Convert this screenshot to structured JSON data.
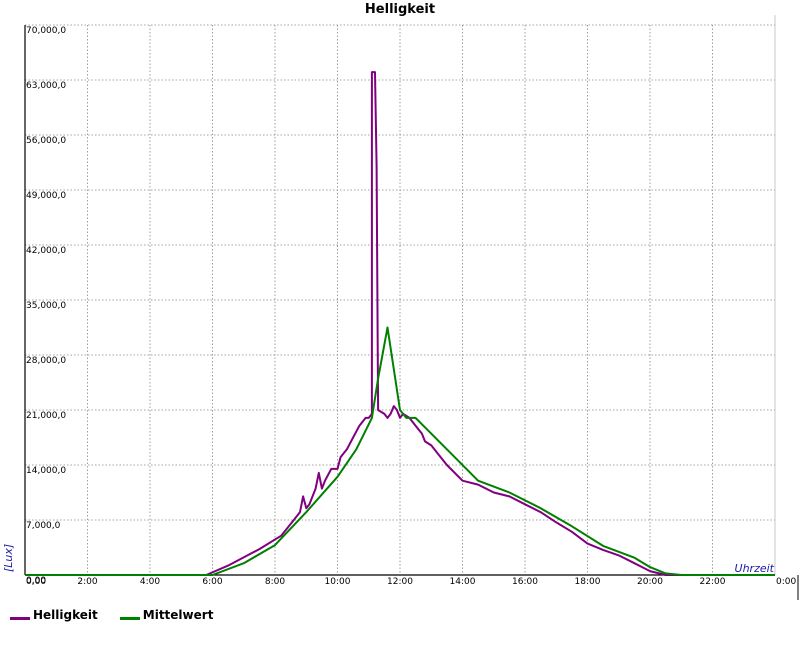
{
  "chart_data": {
    "type": "line",
    "title": "Helligkeit",
    "xlabel": "Uhrzeit",
    "ylabel": "[Lux]",
    "xlim": [
      0,
      24
    ],
    "ylim": [
      0,
      70000
    ],
    "grid": true,
    "legend_position": "bottom-left",
    "y_ticks": [
      "0,00",
      "7,000,0",
      "14,000,0",
      "21,000,0",
      "28,000,0",
      "35,000,0",
      "42,000,0",
      "49,000,0",
      "56,000,0",
      "63,000,0",
      "70,000,0"
    ],
    "x_ticks": [
      "0,00",
      "2:00",
      "4:00",
      "6:00",
      "8:00",
      "10:00",
      "12:00",
      "14:00",
      "16:00",
      "18:00",
      "20:00",
      "22:00",
      "0:00"
    ],
    "series": [
      {
        "name": "Helligkeit",
        "color": "#800080",
        "points": [
          [
            0,
            0
          ],
          [
            5.8,
            0
          ],
          [
            6.5,
            1200
          ],
          [
            7.5,
            3300
          ],
          [
            8.2,
            5000
          ],
          [
            8.6,
            7000
          ],
          [
            8.8,
            8000
          ],
          [
            8.9,
            10000
          ],
          [
            9.0,
            8500
          ],
          [
            9.1,
            9000
          ],
          [
            9.3,
            11000
          ],
          [
            9.4,
            13000
          ],
          [
            9.5,
            11000
          ],
          [
            9.6,
            12000
          ],
          [
            9.8,
            13500
          ],
          [
            10.0,
            13500
          ],
          [
            10.1,
            15000
          ],
          [
            10.3,
            16000
          ],
          [
            10.5,
            17500
          ],
          [
            10.7,
            19000
          ],
          [
            10.9,
            20000
          ],
          [
            11.0,
            20000
          ],
          [
            11.1,
            20500
          ],
          [
            11.1,
            64000
          ],
          [
            11.2,
            64000
          ],
          [
            11.25,
            52000
          ],
          [
            11.3,
            21000
          ],
          [
            11.5,
            20500
          ],
          [
            11.6,
            20000
          ],
          [
            11.7,
            20500
          ],
          [
            11.8,
            21500
          ],
          [
            11.9,
            21000
          ],
          [
            12.0,
            20000
          ],
          [
            12.1,
            20500
          ],
          [
            12.3,
            20000
          ],
          [
            12.5,
            19000
          ],
          [
            12.7,
            18000
          ],
          [
            12.8,
            17000
          ],
          [
            13.0,
            16500
          ],
          [
            13.2,
            15500
          ],
          [
            13.5,
            14000
          ],
          [
            14.0,
            12000
          ],
          [
            14.5,
            11500
          ],
          [
            15.0,
            10500
          ],
          [
            15.5,
            10000
          ],
          [
            16.0,
            9000
          ],
          [
            16.5,
            8000
          ],
          [
            17.0,
            6700
          ],
          [
            17.5,
            5500
          ],
          [
            18.0,
            4000
          ],
          [
            18.5,
            3200
          ],
          [
            19.0,
            2500
          ],
          [
            19.5,
            1500
          ],
          [
            20.0,
            500
          ],
          [
            20.5,
            0
          ],
          [
            24,
            0
          ]
        ]
      },
      {
        "name": "Mittelwert",
        "color": "#008000",
        "points": [
          [
            0,
            0
          ],
          [
            6.0,
            0
          ],
          [
            7.0,
            1500
          ],
          [
            8.0,
            3800
          ],
          [
            9.0,
            8000
          ],
          [
            10.0,
            12500
          ],
          [
            10.6,
            16000
          ],
          [
            11.1,
            20000
          ],
          [
            11.3,
            25000
          ],
          [
            11.6,
            31500
          ],
          [
            12.0,
            21000
          ],
          [
            12.2,
            20000
          ],
          [
            12.5,
            20000
          ],
          [
            13.5,
            16000
          ],
          [
            14.5,
            12000
          ],
          [
            15.5,
            10500
          ],
          [
            16.5,
            8500
          ],
          [
            17.5,
            6200
          ],
          [
            18.5,
            3700
          ],
          [
            19.5,
            2200
          ],
          [
            20.0,
            1000
          ],
          [
            20.5,
            200
          ],
          [
            21.0,
            0
          ],
          [
            24,
            0
          ]
        ]
      }
    ]
  }
}
